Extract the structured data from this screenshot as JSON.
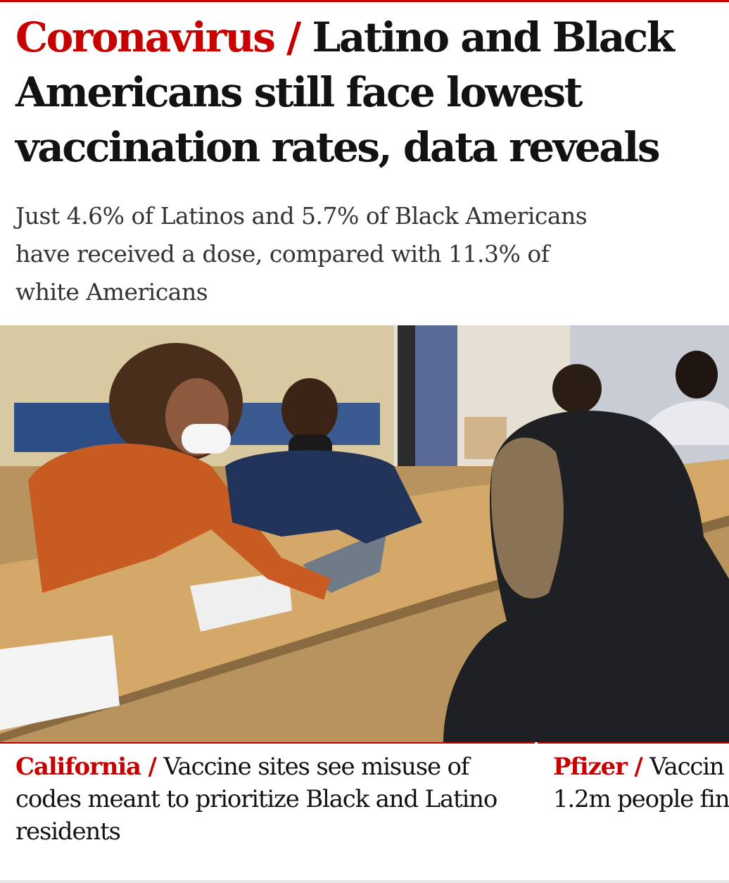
{
  "headline": {
    "kicker": "Coronavirus",
    "separator": " / ",
    "title": "Latino and Black Americans still face lowest vaccination rates, data reveals"
  },
  "standfirst": "Just 4.6% of Latinos and 5.7% of Black Americans have received a dose, compared with 11.3% of white Americans",
  "image": {
    "subject": "vaccination-site-photo"
  },
  "related": [
    {
      "kicker": "California",
      "separator": " / ",
      "title": "Vaccine sites see misuse of codes meant to prioritize Black and Latino residents"
    },
    {
      "kicker": "Pfizer",
      "separator": " / ",
      "title": "Vaccin",
      "title_line2": "1.2m people fin"
    }
  ],
  "colors": {
    "accent": "#c70000",
    "text": "#121212",
    "standfirst": "#333333"
  }
}
